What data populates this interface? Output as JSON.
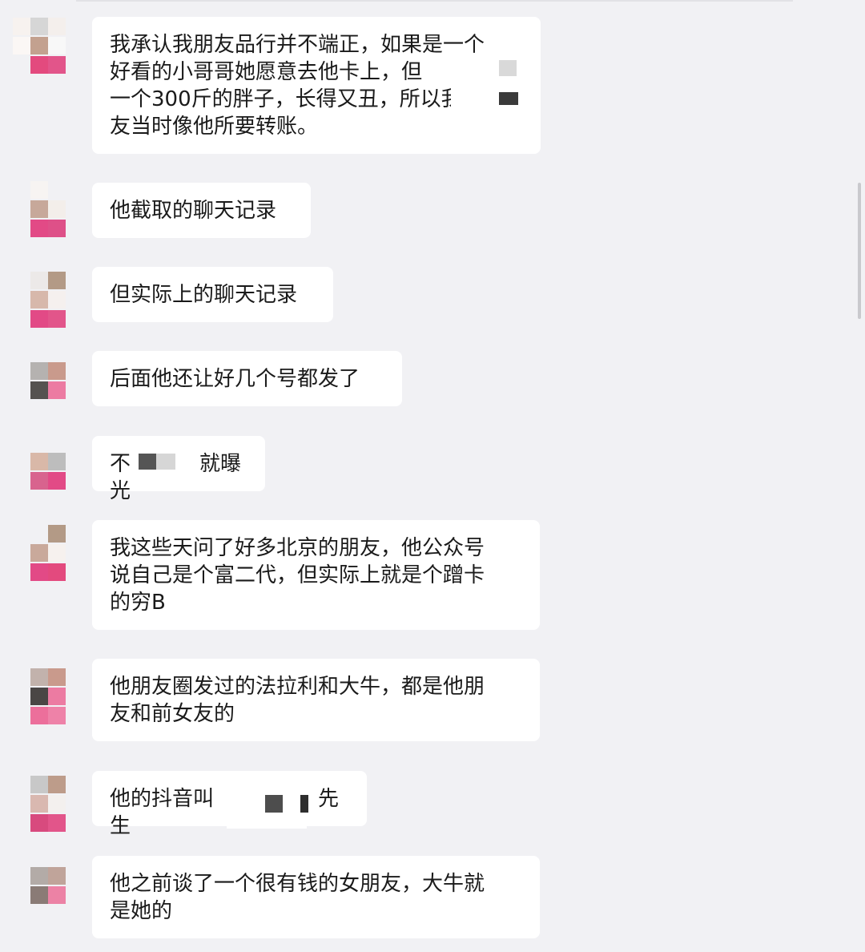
{
  "messages": [
    {
      "lines": [
        "我承认我朋友品行并不端正，如果是一个",
        "好看的小哥哥她愿意去他卡上，但",
        "一个300斤的胖子，长得又丑，所以我朋",
        "友当时像他所要转账。"
      ]
    },
    {
      "lines": [
        "他截取的聊天记录"
      ]
    },
    {
      "lines": [
        "但实际上的聊天记录"
      ]
    },
    {
      "lines": [
        "后面他还让好几个号都发了"
      ]
    },
    {
      "lines": [
        "不",
        "就曝光"
      ]
    },
    {
      "lines": [
        "我这些天问了好多北京的朋友，他公众号",
        "说自己是个富二代，但实际上就是个蹭卡",
        "的穷B"
      ]
    },
    {
      "lines": [
        "他朋友圈发过的法拉利和大牛，都是他朋",
        "友和前女友的"
      ]
    },
    {
      "lines": [
        "他的抖音叫",
        "先生"
      ]
    },
    {
      "lines": [
        "他之前谈了一个很有钱的女朋友，大牛就",
        "是她的"
      ]
    }
  ],
  "colors": {
    "background": "#f1f1f4",
    "bubble": "#ffffff",
    "text": "#1a1a1a",
    "avatar_accent": "#e24a86"
  }
}
